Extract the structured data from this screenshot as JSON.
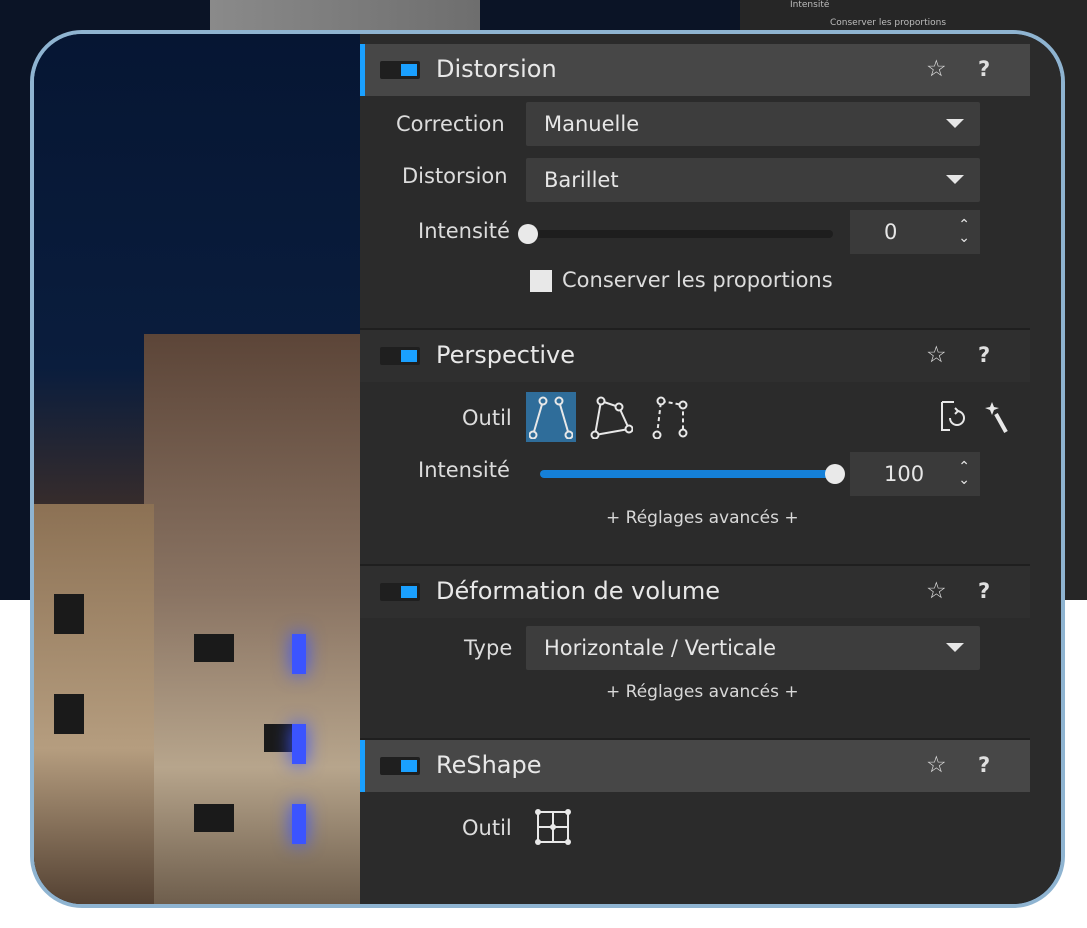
{
  "background": {
    "hint_line1": "Intensité",
    "hint_line2": "Conserver les proportions"
  },
  "sections": {
    "distorsion": {
      "title": "Distorsion",
      "correction_label": "Correction",
      "correction_value": "Manuelle",
      "distorsion_label": "Distorsion",
      "distorsion_value": "Barillet",
      "intensity_label": "Intensité",
      "intensity_value": "0",
      "intensity_level": 0,
      "keep_proportions_label": "Conserver les proportions"
    },
    "perspective": {
      "title": "Perspective",
      "tool_label": "Outil",
      "intensity_label": "Intensité",
      "intensity_value": "100",
      "intensity_level": 1.0,
      "advanced_link": "+ Réglages avancés +"
    },
    "volume": {
      "title": "Déformation de volume",
      "type_label": "Type",
      "type_value": "Horizontale / Verticale",
      "advanced_link": "+ Réglages avancés +"
    },
    "reshape": {
      "title": "ReShape",
      "tool_label": "Outil"
    }
  },
  "icons": {
    "star": "☆",
    "help": "?",
    "collapse": "›"
  },
  "colors": {
    "accent": "#1aa0ff",
    "frame": "#8fb4d1",
    "panel": "#2b2b2b"
  }
}
